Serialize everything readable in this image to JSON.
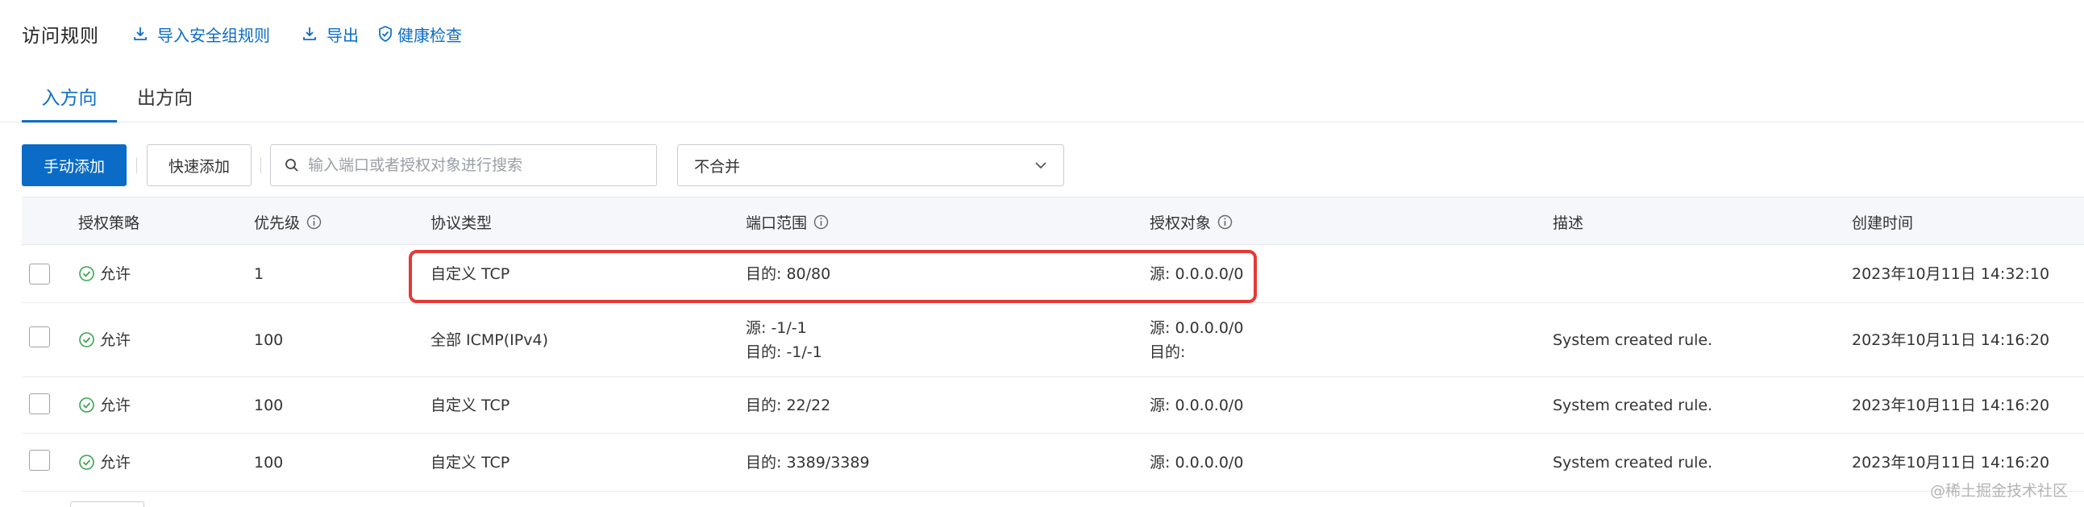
{
  "header": {
    "title": "访问规则",
    "links": [
      {
        "label": "导入安全组规则",
        "icon": "import-icon"
      },
      {
        "label": "导出",
        "icon": "export-icon"
      },
      {
        "label": "健康检查",
        "icon": "shield-check-icon"
      }
    ]
  },
  "tabs": [
    {
      "label": "入方向",
      "active": true
    },
    {
      "label": "出方向",
      "active": false
    }
  ],
  "toolbar": {
    "add_manual_label": "手动添加",
    "add_quick_label": "快速添加",
    "search_placeholder": "输入端口或者授权对象进行搜索",
    "merge_select_value": "不合并"
  },
  "table": {
    "columns": {
      "policy": "授权策略",
      "priority": "优先级",
      "protocol": "协议类型",
      "port_range": "端口范围",
      "auth_object": "授权对象",
      "description": "描述",
      "created_at": "创建时间"
    },
    "rows": [
      {
        "policy": "允许",
        "priority": "1",
        "protocol": "自定义 TCP",
        "port_lines": [
          "目的: 80/80"
        ],
        "auth_lines": [
          "源: 0.0.0.0/0"
        ],
        "description": "",
        "created_at": "2023年10月11日 14:32:10"
      },
      {
        "policy": "允许",
        "priority": "100",
        "protocol": "全部 ICMP(IPv4)",
        "port_lines": [
          "源: -1/-1",
          "目的: -1/-1"
        ],
        "auth_lines": [
          "源: 0.0.0.0/0",
          "目的:"
        ],
        "description": "System created rule.",
        "created_at": "2023年10月11日 14:16:20"
      },
      {
        "policy": "允许",
        "priority": "100",
        "protocol": "自定义 TCP",
        "port_lines": [
          "目的: 22/22"
        ],
        "auth_lines": [
          "源: 0.0.0.0/0"
        ],
        "description": "System created rule.",
        "created_at": "2023年10月11日 14:16:20"
      },
      {
        "policy": "允许",
        "priority": "100",
        "protocol": "自定义 TCP",
        "port_lines": [
          "目的: 3389/3389"
        ],
        "auth_lines": [
          "源: 0.0.0.0/0"
        ],
        "description": "System created rule.",
        "created_at": "2023年10月11日 14:16:20"
      }
    ]
  },
  "watermark": "@稀土掘金技术社区",
  "colors": {
    "accent": "#0b6cc7",
    "allow_green": "#3aa452",
    "highlight_red": "#e53935",
    "header_bg": "#f5f7fa"
  }
}
